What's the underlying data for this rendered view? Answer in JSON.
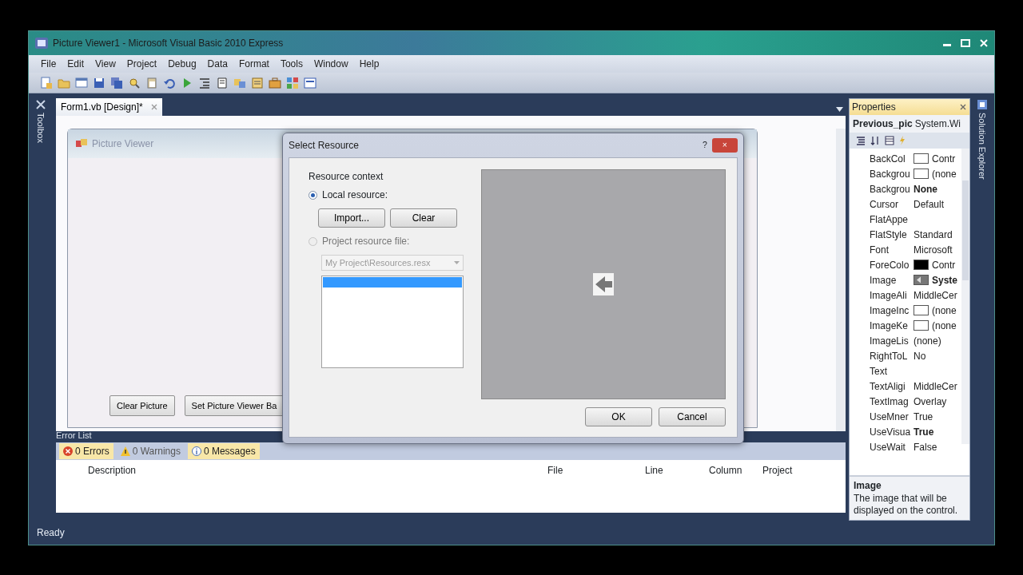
{
  "window": {
    "title": "Picture Viewer1 - Microsoft Visual Basic 2010 Express"
  },
  "menu": [
    "File",
    "Edit",
    "View",
    "Project",
    "Debug",
    "Data",
    "Format",
    "Tools",
    "Window",
    "Help"
  ],
  "side_tabs": {
    "left": "Toolbox",
    "right": "Solution Explorer"
  },
  "document_tabs": [
    {
      "label": "Form1.vb [Design]*",
      "selected": true
    }
  ],
  "form": {
    "title": "Picture Viewer",
    "buttons": [
      "Clear Picture",
      "Set Picture Viewer Ba"
    ]
  },
  "error_list": {
    "title": "Error List",
    "filters": [
      {
        "kind": "error",
        "label": "0 Errors",
        "on": true
      },
      {
        "kind": "warning",
        "label": "0 Warnings",
        "on": false
      },
      {
        "kind": "info",
        "label": "0 Messages",
        "on": true
      }
    ],
    "columns": [
      "Description",
      "File",
      "Line",
      "Column",
      "Project"
    ]
  },
  "status_bar": "Ready",
  "properties": {
    "title": "Properties",
    "object": "Previous_pic",
    "object_type": "System.Wi",
    "rows": [
      {
        "kind": "blank",
        "name": "BackCol",
        "value": "Contr",
        "bold": false
      },
      {
        "kind": "blank",
        "name": "Backgrou",
        "value": "(none",
        "bold": false
      },
      {
        "kind": "text",
        "name": "Backgrou",
        "value": "None",
        "bold": true
      },
      {
        "kind": "text",
        "name": "Cursor",
        "value": "Default",
        "bold": false
      },
      {
        "kind": "text",
        "name": "FlatAppe"
      },
      {
        "kind": "text",
        "name": "FlatStyle",
        "value": "Standard",
        "bold": false
      },
      {
        "kind": "text",
        "name": "Font",
        "value": "Microsoft",
        "bold": false
      },
      {
        "kind": "black",
        "name": "ForeColo",
        "value": "Contr",
        "bold": false
      },
      {
        "kind": "image",
        "name": "Image",
        "value": "Syste",
        "bold": true
      },
      {
        "kind": "text",
        "name": "ImageAli",
        "value": "MiddleCer",
        "bold": false
      },
      {
        "kind": "blank",
        "name": "ImageInc",
        "value": "(none",
        "bold": false
      },
      {
        "kind": "blank",
        "name": "ImageKe",
        "value": "(none",
        "bold": false
      },
      {
        "kind": "text",
        "name": "ImageLis",
        "value": "(none)",
        "bold": false
      },
      {
        "kind": "text",
        "name": "RightToL",
        "value": "No",
        "bold": false
      },
      {
        "kind": "text",
        "name": "Text"
      },
      {
        "kind": "text",
        "name": "TextAligi",
        "value": "MiddleCer",
        "bold": false
      },
      {
        "kind": "text",
        "name": "TextImag",
        "value": "Overlay",
        "bold": false
      },
      {
        "kind": "text",
        "name": "UseMner",
        "value": "True",
        "bold": false
      },
      {
        "kind": "text",
        "name": "UseVisua",
        "value": "True",
        "bold": true
      },
      {
        "kind": "text",
        "name": "UseWait",
        "value": "False",
        "bold": false
      }
    ],
    "description_title": "Image",
    "description": "The image that will be displayed on the control."
  },
  "dialog": {
    "title": "Select Resource",
    "help": "?",
    "close": "×",
    "group_label": "Resource context",
    "options": [
      {
        "label": "Local resource:",
        "selected": true,
        "disabled": false
      },
      {
        "label": "Project resource file:",
        "selected": false,
        "disabled": true
      }
    ],
    "buttons": [
      "Import...",
      "Clear"
    ],
    "resource_file": {
      "value": "My Project\\Resources.resx",
      "disabled": true
    },
    "resource_list": [
      {
        "selected": true
      }
    ],
    "actions": [
      "OK",
      "Cancel"
    ]
  }
}
